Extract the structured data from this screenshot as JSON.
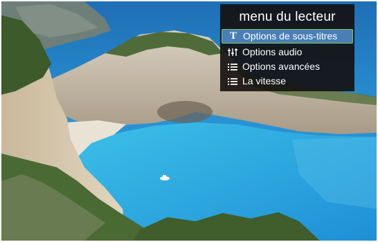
{
  "player_menu": {
    "title": "menu du lecteur",
    "items": [
      {
        "label": "Options de sous-titres",
        "icon": "subtitles-icon",
        "glyph": "T",
        "selected": true
      },
      {
        "label": "Options audio",
        "icon": "audio-equalizer-icon",
        "selected": false
      },
      {
        "label": "Options avancées",
        "icon": "list-icon",
        "selected": false
      },
      {
        "label": "La vitesse",
        "icon": "list-icon",
        "selected": false
      }
    ]
  },
  "colors": {
    "menu_background": "#14100e",
    "selection_fill": "#4a7fb6",
    "selection_border": "#7fc36a",
    "sea": "#2f8fcf"
  }
}
